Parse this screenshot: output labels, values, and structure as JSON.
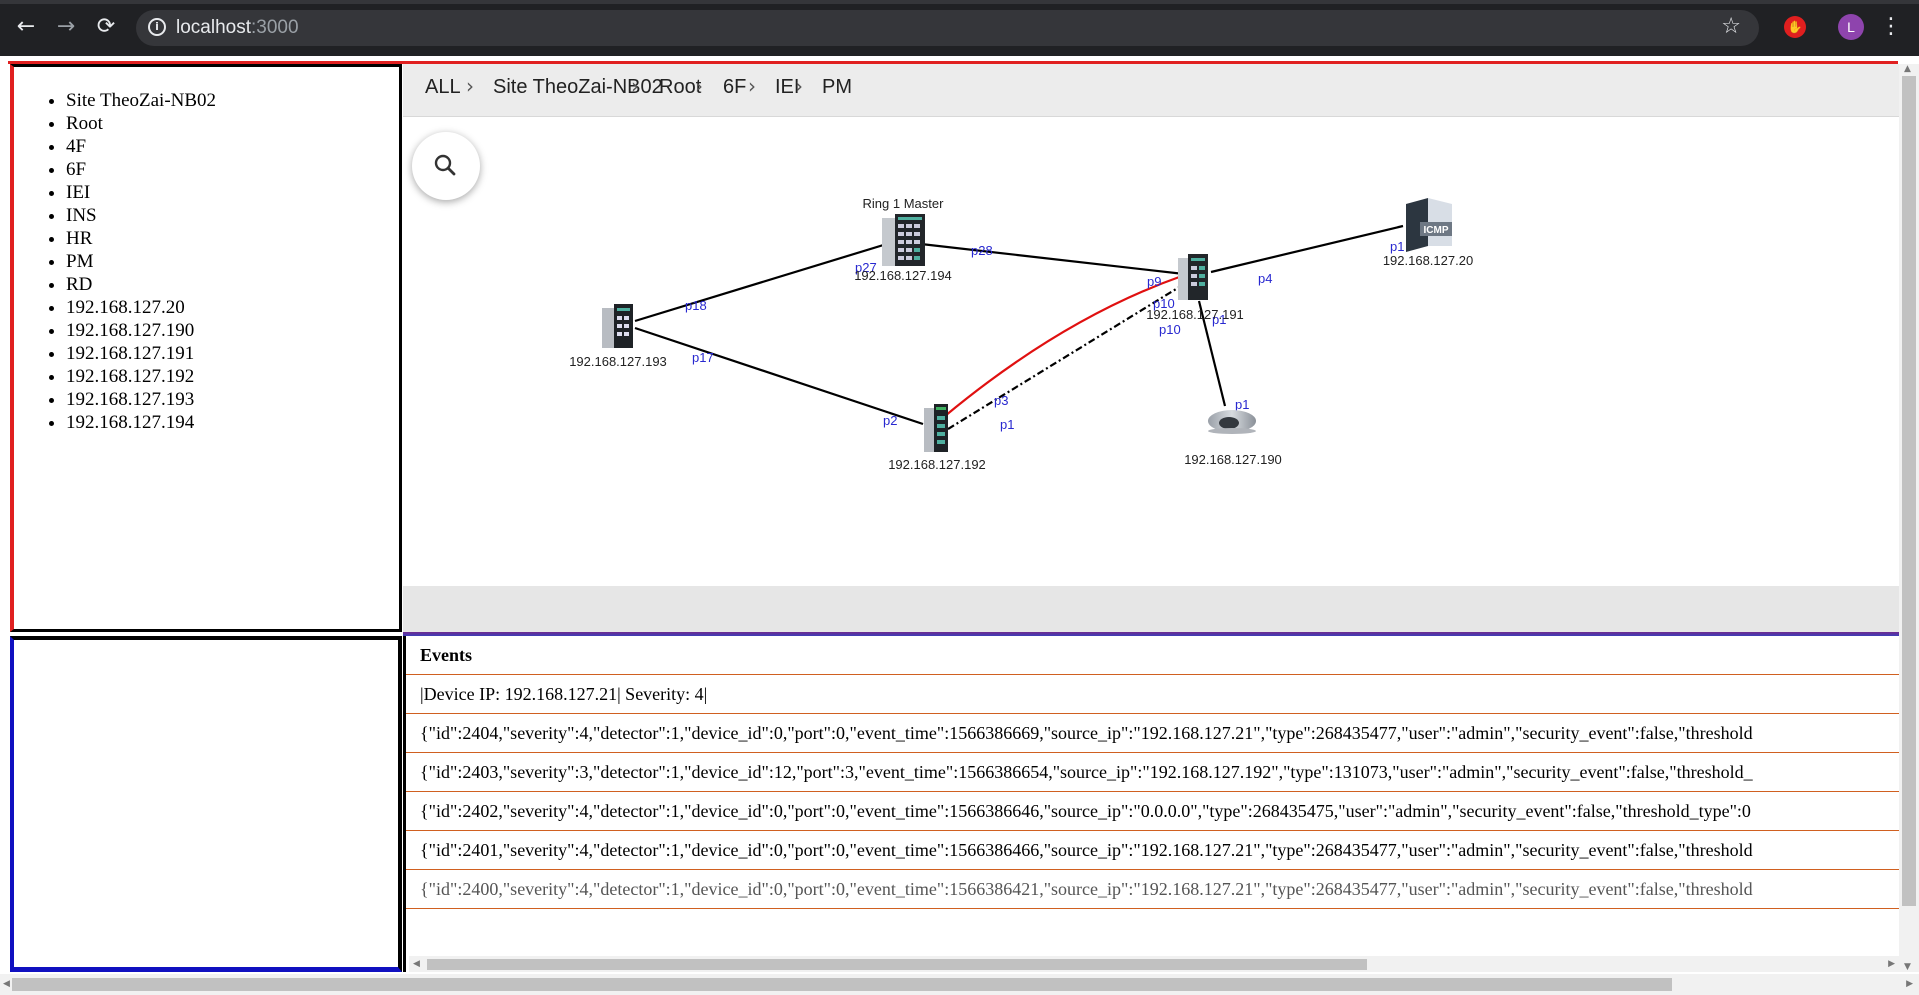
{
  "browser": {
    "url_host": "localhost",
    "url_port": ":3000",
    "avatar_letter": "L",
    "back_icon": "←",
    "forward_icon": "→",
    "reload_icon": "⟳",
    "star_icon": "☆",
    "menu_icon": "⋮"
  },
  "tree": {
    "items": [
      "Site TheoZai-NB02",
      "Root",
      "4F",
      "6F",
      "IEI",
      "INS",
      "HR",
      "PM",
      "RD",
      "192.168.127.20",
      "192.168.127.190",
      "192.168.127.191",
      "192.168.127.192",
      "192.168.127.193",
      "192.168.127.194"
    ]
  },
  "breadcrumb": [
    "ALL",
    "Site TheoZai-NB02",
    "Root",
    "6F",
    "IEI",
    "PM"
  ],
  "topology": {
    "devices": {
      "d194": {
        "ip": "192.168.127.194",
        "label": "Ring 1 Master"
      },
      "d193": {
        "ip": "192.168.127.193"
      },
      "d192": {
        "ip": "192.168.127.192"
      },
      "d191": {
        "ip": "192.168.127.191"
      },
      "d190": {
        "ip": "192.168.127.190"
      },
      "d20": {
        "ip": "192.168.127.20",
        "badge": "ICMP"
      }
    },
    "ports": {
      "p18": "p18",
      "p17": "p17",
      "p27": "p27",
      "p28": "p28",
      "p2": "p2",
      "p3": "p3",
      "p1": "p1",
      "p9": "p9",
      "p10a": "p10",
      "p10b": "p10",
      "p1_191": "p1",
      "p4": "p4",
      "p1_20": "p1",
      "p1_190": "p1"
    },
    "colors": {
      "link": "#000000",
      "redundant": "#e01010",
      "port_label": "#2828d0"
    }
  },
  "events": {
    "title": "Events",
    "filter": "|Device IP: 192.168.127.21| Severity: 4|",
    "rows": [
      "{\"id\":2404,\"severity\":4,\"detector\":1,\"device_id\":0,\"port\":0,\"event_time\":1566386669,\"source_ip\":\"192.168.127.21\",\"type\":268435477,\"user\":\"admin\",\"security_event\":false,\"threshold",
      "{\"id\":2403,\"severity\":3,\"detector\":1,\"device_id\":12,\"port\":3,\"event_time\":1566386654,\"source_ip\":\"192.168.127.192\",\"type\":131073,\"user\":\"admin\",\"security_event\":false,\"threshold_",
      "{\"id\":2402,\"severity\":4,\"detector\":1,\"device_id\":0,\"port\":0,\"event_time\":1566386646,\"source_ip\":\"0.0.0.0\",\"type\":268435475,\"user\":\"admin\",\"security_event\":false,\"threshold_type\":0",
      "{\"id\":2401,\"severity\":4,\"detector\":1,\"device_id\":0,\"port\":0,\"event_time\":1566386466,\"source_ip\":\"192.168.127.21\",\"type\":268435477,\"user\":\"admin\",\"security_event\":false,\"threshold",
      "{\"id\":2400,\"severity\":4,\"detector\":1,\"device_id\":0,\"port\":0,\"event_time\":1566386421,\"source_ip\":\"192.168.127.21\",\"type\":268435477,\"user\":\"admin\",\"security_event\":false,\"threshold"
    ]
  }
}
